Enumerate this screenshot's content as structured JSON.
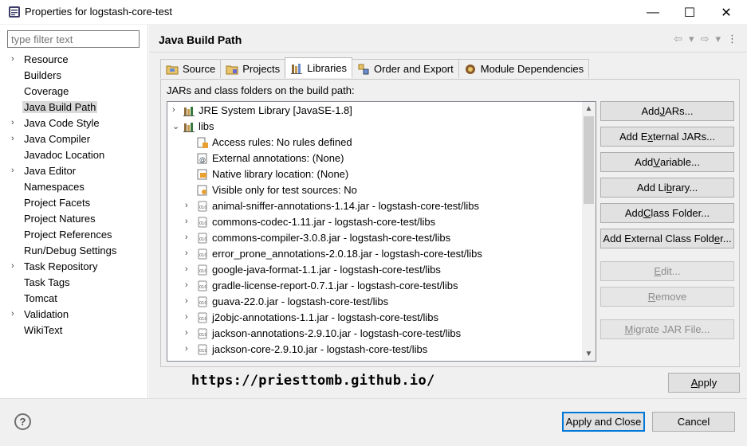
{
  "window": {
    "title": "Properties for logstash-core-test",
    "minimize": "—",
    "maximize": "☐",
    "close": "✕"
  },
  "filter": {
    "placeholder": "type filter text"
  },
  "nav": [
    {
      "label": "Resource",
      "expandable": true
    },
    {
      "label": "Builders",
      "expandable": false
    },
    {
      "label": "Coverage",
      "expandable": false
    },
    {
      "label": "Java Build Path",
      "expandable": false,
      "selected": true
    },
    {
      "label": "Java Code Style",
      "expandable": true
    },
    {
      "label": "Java Compiler",
      "expandable": true
    },
    {
      "label": "Javadoc Location",
      "expandable": false
    },
    {
      "label": "Java Editor",
      "expandable": true
    },
    {
      "label": "Namespaces",
      "expandable": false
    },
    {
      "label": "Project Facets",
      "expandable": false
    },
    {
      "label": "Project Natures",
      "expandable": false
    },
    {
      "label": "Project References",
      "expandable": false
    },
    {
      "label": "Run/Debug Settings",
      "expandable": false
    },
    {
      "label": "Task Repository",
      "expandable": true
    },
    {
      "label": "Task Tags",
      "expandable": false
    },
    {
      "label": "Tomcat",
      "expandable": false
    },
    {
      "label": "Validation",
      "expandable": true
    },
    {
      "label": "WikiText",
      "expandable": false
    }
  ],
  "page": {
    "title": "Java Build Path",
    "build_path_label": "JARs and class folders on the build path:"
  },
  "tabs": [
    {
      "label": "Source",
      "icon": "source-folder-icon"
    },
    {
      "label": "Projects",
      "icon": "projects-folder-icon"
    },
    {
      "label": "Libraries",
      "icon": "libraries-icon",
      "active": true
    },
    {
      "label": "Order and Export",
      "icon": "order-export-icon"
    },
    {
      "label": "Module Dependencies",
      "icon": "module-icon"
    }
  ],
  "tree": [
    {
      "text": "JRE System Library [JavaSE-1.8]",
      "level": 0,
      "chev": "›",
      "icon": "library"
    },
    {
      "text": "libs",
      "level": 0,
      "chev": "⌄",
      "icon": "library"
    },
    {
      "text": "Access rules: No rules defined",
      "level": 1,
      "chev": "",
      "icon": "access"
    },
    {
      "text": "External annotations: (None)",
      "level": 1,
      "chev": "",
      "icon": "annot"
    },
    {
      "text": "Native library location: (None)",
      "level": 1,
      "chev": "",
      "icon": "native"
    },
    {
      "text": "Visible only for test sources: No",
      "level": 1,
      "chev": "",
      "icon": "visible"
    },
    {
      "text": "animal-sniffer-annotations-1.14.jar - logstash-core-test/libs",
      "level": 1,
      "chev": "›",
      "icon": "jar"
    },
    {
      "text": "commons-codec-1.11.jar - logstash-core-test/libs",
      "level": 1,
      "chev": "›",
      "icon": "jar"
    },
    {
      "text": "commons-compiler-3.0.8.jar - logstash-core-test/libs",
      "level": 1,
      "chev": "›",
      "icon": "jar"
    },
    {
      "text": "error_prone_annotations-2.0.18.jar - logstash-core-test/libs",
      "level": 1,
      "chev": "›",
      "icon": "jar"
    },
    {
      "text": "google-java-format-1.1.jar - logstash-core-test/libs",
      "level": 1,
      "chev": "›",
      "icon": "jar"
    },
    {
      "text": "gradle-license-report-0.7.1.jar - logstash-core-test/libs",
      "level": 1,
      "chev": "›",
      "icon": "jar"
    },
    {
      "text": "guava-22.0.jar - logstash-core-test/libs",
      "level": 1,
      "chev": "›",
      "icon": "jar"
    },
    {
      "text": "j2objc-annotations-1.1.jar - logstash-core-test/libs",
      "level": 1,
      "chev": "›",
      "icon": "jar"
    },
    {
      "text": "jackson-annotations-2.9.10.jar - logstash-core-test/libs",
      "level": 1,
      "chev": "›",
      "icon": "jar"
    },
    {
      "text": "jackson-core-2.9.10.jar - logstash-core-test/libs",
      "level": 1,
      "chev": "›",
      "icon": "jar"
    }
  ],
  "buttons": {
    "add_jars": {
      "pre": "Add ",
      "u": "J",
      "post": "ARs..."
    },
    "add_external_jars": {
      "pre": "Add E",
      "u": "x",
      "post": "ternal JARs..."
    },
    "add_variable": {
      "pre": "Add ",
      "u": "V",
      "post": "ariable..."
    },
    "add_library": {
      "pre": "Add Li",
      "u": "b",
      "post": "rary..."
    },
    "add_class_folder": {
      "pre": "Add ",
      "u": "C",
      "post": "lass Folder..."
    },
    "add_external_class_folder": {
      "pre": "Add External Class Fold",
      "u": "e",
      "post": "r..."
    },
    "edit": {
      "pre": "",
      "u": "E",
      "post": "dit..."
    },
    "remove": {
      "pre": "",
      "u": "R",
      "post": "emove"
    },
    "migrate": {
      "pre": "",
      "u": "M",
      "post": "igrate JAR File..."
    },
    "apply": {
      "pre": "",
      "u": "A",
      "post": "pply"
    },
    "apply_and_close": "Apply and Close",
    "cancel": "Cancel"
  },
  "watermark": "https://priesttomb.github.io/",
  "help": "?",
  "colors": {
    "accent": "#0078d7",
    "selection": "#d9d9d9"
  }
}
